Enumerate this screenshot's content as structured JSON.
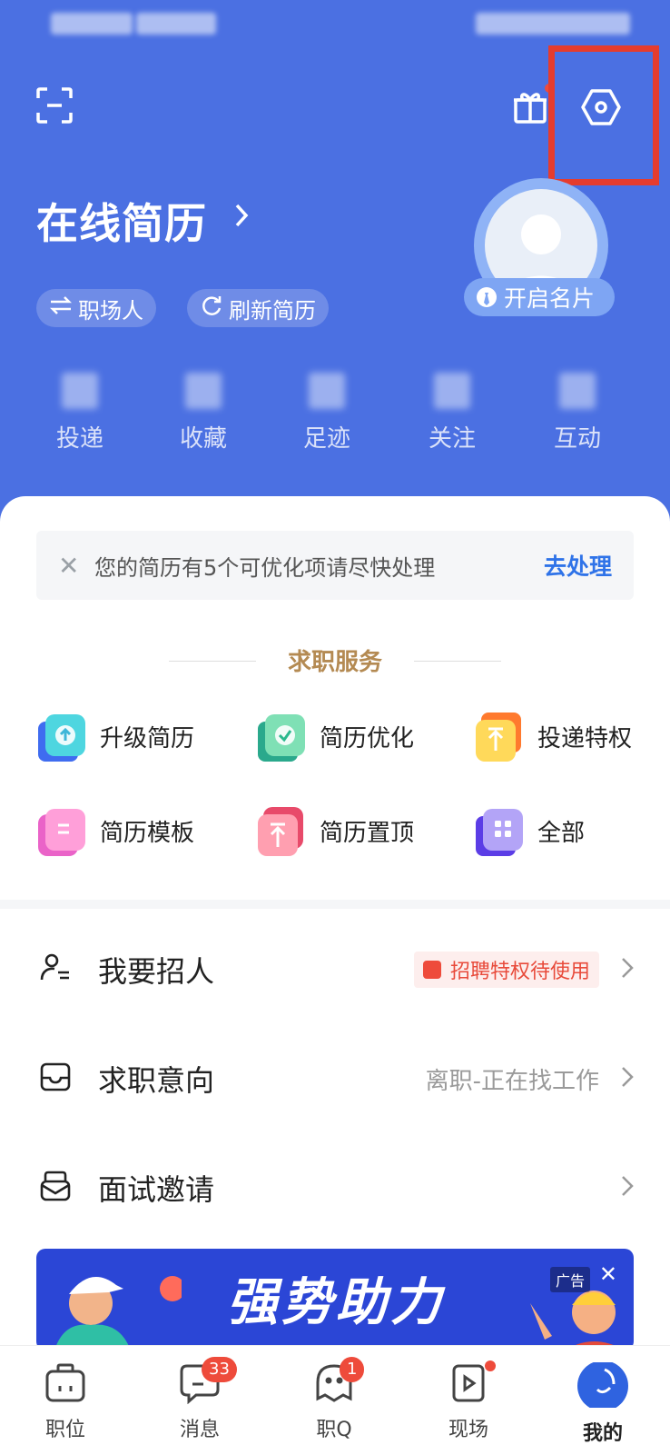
{
  "header": {
    "title": "在线简历",
    "pills": [
      "职场人",
      "刷新简历"
    ],
    "card_button": "开启名片",
    "stats": [
      "投递",
      "收藏",
      "足迹",
      "关注",
      "互动"
    ]
  },
  "notice": {
    "message": "您的简历有5个可优化项请尽快处理",
    "action": "去处理"
  },
  "services": {
    "title": "求职服务",
    "items": [
      "升级简历",
      "简历优化",
      "投递特权",
      "简历模板",
      "简历置顶",
      "全部"
    ]
  },
  "rows": {
    "recruit": {
      "label": "我要招人",
      "badge": "招聘特权待使用"
    },
    "intent": {
      "label": "求职意向",
      "value": "离职-正在找工作"
    },
    "interview": {
      "label": "面试邀请"
    }
  },
  "banner": {
    "text": "强势助力",
    "ad_label": "广告"
  },
  "tabs": {
    "items": [
      "职位",
      "消息",
      "职Q",
      "现场",
      "我的"
    ],
    "message_badge": "33",
    "q_badge": "1"
  },
  "colors": {
    "brand": "#4b70e2",
    "accent": "#2f73e8",
    "gold": "#b48a52",
    "alert": "#ee4b3b"
  }
}
